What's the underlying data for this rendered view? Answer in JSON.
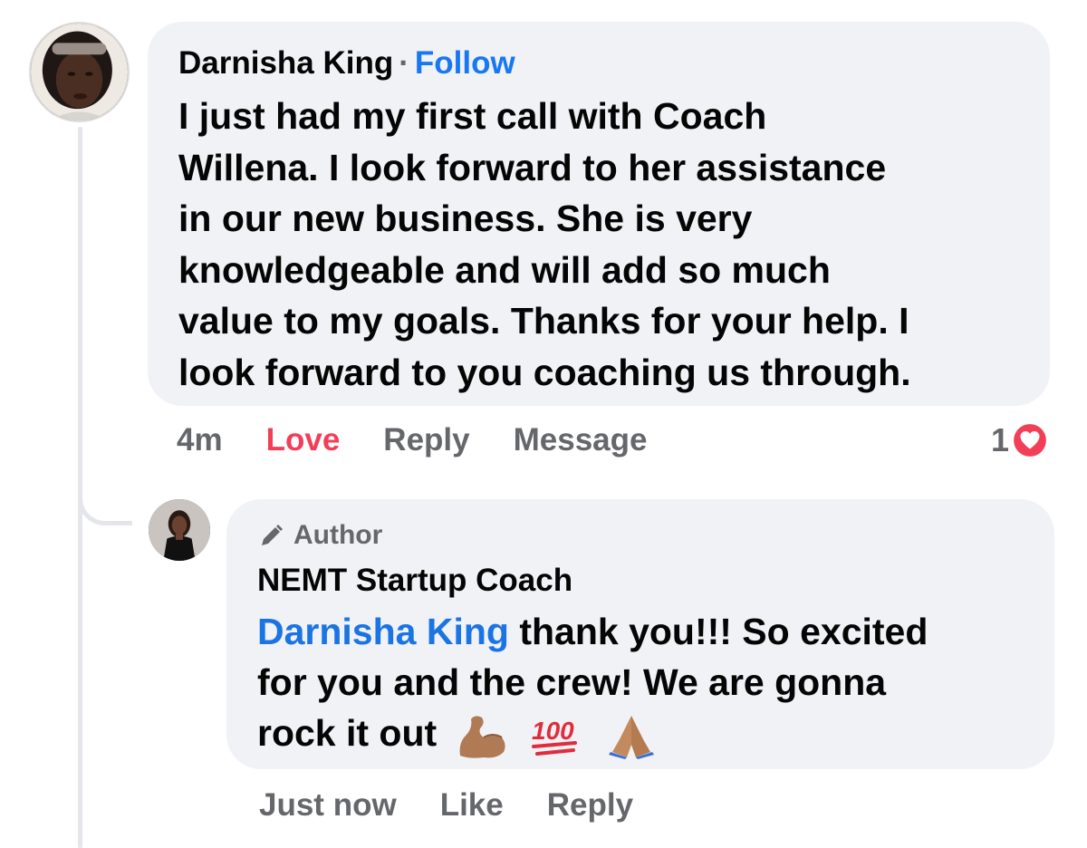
{
  "comment": {
    "author": "Darnisha King",
    "separator": "·",
    "follow_label": "Follow",
    "text_lines": [
      "I just had my first call with Coach",
      "Willena. I look forward to her assistance",
      "in our new business. She is very",
      "knowledgeable and will add so much",
      "value to my goals. Thanks for your help. I",
      "look forward to you coaching us through."
    ],
    "timestamp": "4m",
    "actions": {
      "love": "Love",
      "reply": "Reply",
      "message": "Message"
    },
    "reaction_count": "1",
    "reaction_icon": "heart-icon",
    "colors": {
      "love_active": "#f33e58",
      "follow": "#1877f2",
      "bubble": "#f0f2f5",
      "meta": "#65676b"
    }
  },
  "reply": {
    "badge": "Author",
    "badge_icon": "pencil-icon",
    "author": "NEMT Startup Coach",
    "mention": "Darnisha King",
    "text_line1_rest": " thank you!!! So excited",
    "text_line2": "for you and the crew! We are gonna",
    "text_line3": "rock it out",
    "emojis": [
      "flexed-biceps-emoji",
      "hundred-points-emoji",
      "folded-hands-emoji"
    ],
    "timestamp": "Just now",
    "actions": {
      "like": "Like",
      "reply": "Reply"
    },
    "colors": {
      "mention": "#1b74e4"
    }
  }
}
